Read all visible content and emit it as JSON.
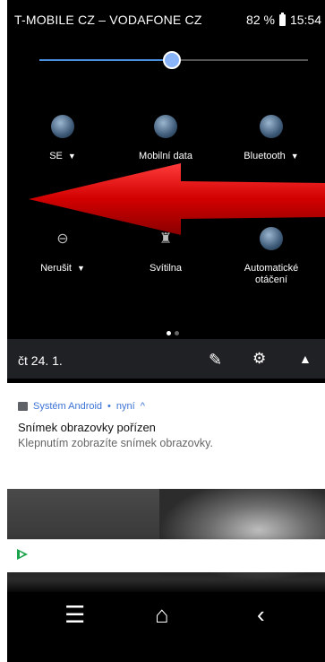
{
  "status_bar": {
    "carrier": "T-MOBILE CZ – VODAFONE CZ",
    "battery": "82 %",
    "time": "15:54"
  },
  "brightness": {
    "level": 0.52
  },
  "tiles": [
    {
      "label": "SE",
      "has_menu": true,
      "icon": "wifi-icon"
    },
    {
      "label": "Mobilní data",
      "has_menu": false,
      "icon": "mobile-data-icon"
    },
    {
      "label": "Bluetooth",
      "has_menu": true,
      "icon": "bluetooth-icon"
    },
    {
      "label": "Nerušit",
      "has_menu": true,
      "icon": "do-not-disturb-icon"
    },
    {
      "label": "Svítilna",
      "has_menu": false,
      "icon": "flashlight-icon"
    },
    {
      "label_line1": "Automatické",
      "label_line2": "otáčení",
      "has_menu": false,
      "icon": "auto-rotate-icon"
    }
  ],
  "quick_settings": {
    "date": "čt 24. 1."
  },
  "notification": {
    "app": "Systém Android",
    "time": "nyní",
    "title": "Snímek obrazovky pořízen",
    "text": "Klepnutím zobrazíte snímek obrazovky."
  },
  "colors": {
    "accent": "#3b73d6",
    "annotation_arrow": "#d10000",
    "panel": "#202124"
  }
}
